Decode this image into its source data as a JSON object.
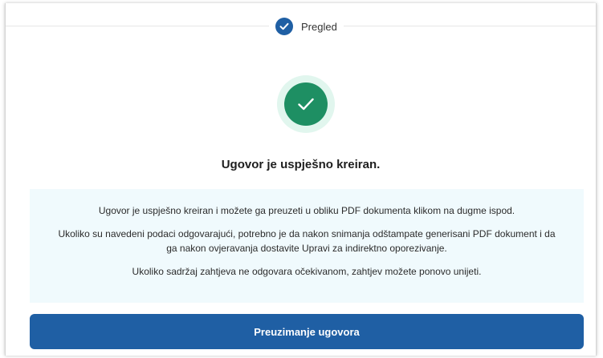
{
  "stepper": {
    "step_label": "Pregled",
    "step_icon": "check-icon"
  },
  "success": {
    "icon": "check-icon",
    "title": "Ugovor je uspješno kreiran."
  },
  "info": {
    "paragraphs": [
      "Ugovor je uspješno kreiran i možete ga preuzeti u obliku PDF dokumenta klikom na dugme ispod.",
      "Ukoliko su navedeni podaci odgovarajući, potrebno je da nakon snimanja odštampate generisani PDF dokument i da ga nakon ovjeravanja dostavite Upravi za indirektno oporezivanje.",
      "Ukoliko sadržaj zahtjeva ne odgovara očekivanom, zahtjev možete ponovo unijeti."
    ]
  },
  "actions": {
    "download_label": "Preuzimanje ugovora"
  },
  "colors": {
    "primary": "#1f5fa4",
    "success": "#1e8f63",
    "success_halo": "#e1f6ee",
    "info_background": "#f0fafd"
  }
}
